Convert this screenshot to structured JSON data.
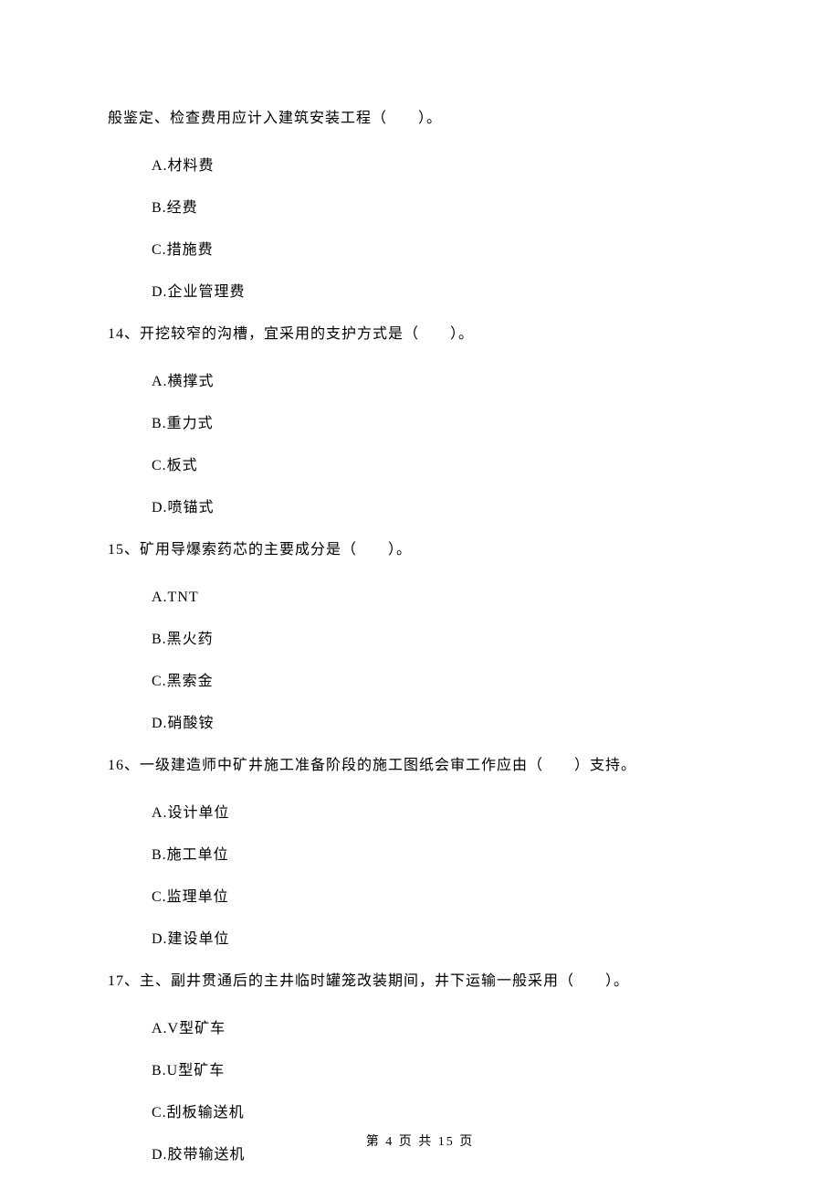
{
  "q13": {
    "continuation": "般鉴定、检查费用应计入建筑安装工程（　　）。",
    "options": {
      "a": "A.材料费",
      "b": "B.经费",
      "c": "C.措施费",
      "d": "D.企业管理费"
    }
  },
  "q14": {
    "text": "14、开挖较窄的沟槽，宜采用的支护方式是（　　）。",
    "options": {
      "a": "A.横撑式",
      "b": "B.重力式",
      "c": "C.板式",
      "d": "D.喷锚式"
    }
  },
  "q15": {
    "text": "15、矿用导爆索药芯的主要成分是（　　）。",
    "options": {
      "a": "A.TNT",
      "b": "B.黑火药",
      "c": "C.黑索金",
      "d": "D.硝酸铵"
    }
  },
  "q16": {
    "text": "16、一级建造师中矿井施工准备阶段的施工图纸会审工作应由（　　）支持。",
    "options": {
      "a": "A.设计单位",
      "b": "B.施工单位",
      "c": "C.监理单位",
      "d": "D.建设单位"
    }
  },
  "q17": {
    "text": "17、主、副井贯通后的主井临时罐笼改装期间，井下运输一般采用（　　）。",
    "options": {
      "a": "A.V型矿车",
      "b": "B.U型矿车",
      "c": "C.刮板输送机",
      "d": "D.胶带输送机"
    }
  },
  "footer": "第 4 页 共 15 页"
}
